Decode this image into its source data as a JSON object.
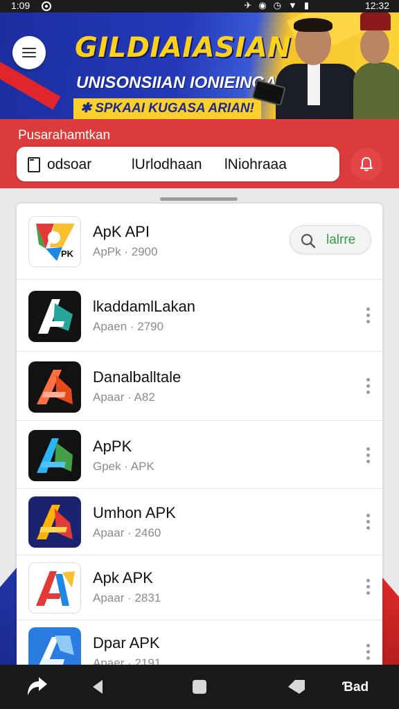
{
  "status_bar": {
    "time": "1:09",
    "clock": "12:32"
  },
  "banner": {
    "headline": "GILDIAIASIAN",
    "subtitle": "UNISONSIIAN IONIEINGA",
    "promo": "✱ SPKAAI KUGASA ARIAN!"
  },
  "search": {
    "title": "Pusarahamtkan",
    "segments": [
      "odsoar",
      "lUrlodhaan",
      "lNiohraaa"
    ]
  },
  "apps": [
    {
      "name": "ApK API",
      "meta": "ApPk · 2900",
      "icon": "apk-api-app-icon",
      "action": "lalrre"
    },
    {
      "name": "lkaddamlLakan",
      "meta": "Apaen · 2790",
      "icon": "green-a-app-icon"
    },
    {
      "name": "Danalballtale",
      "meta": "Apaar · A82",
      "icon": "orange-a-app-icon"
    },
    {
      "name": "ApPK",
      "meta": "Gpek · APK",
      "icon": "blue-green-a-app-icon"
    },
    {
      "name": "Umhon APK",
      "meta": "Apaar · 2460",
      "icon": "gold-a-app-icon"
    },
    {
      "name": "Apk APK",
      "meta": "Apaar · 2831",
      "icon": "red-blue-a-app-icon"
    },
    {
      "name": "Dpar APK",
      "meta": "Apaer · 2191",
      "icon": "blue-a-app-icon"
    }
  ],
  "icon_label": "PK",
  "nav": {
    "right_label": "Ɓad"
  },
  "colors": {
    "header_red": "#dc3b3b",
    "banner_blue": "#2439b8",
    "banner_yellow": "#fbd43a",
    "action_green": "#3a9a46"
  }
}
